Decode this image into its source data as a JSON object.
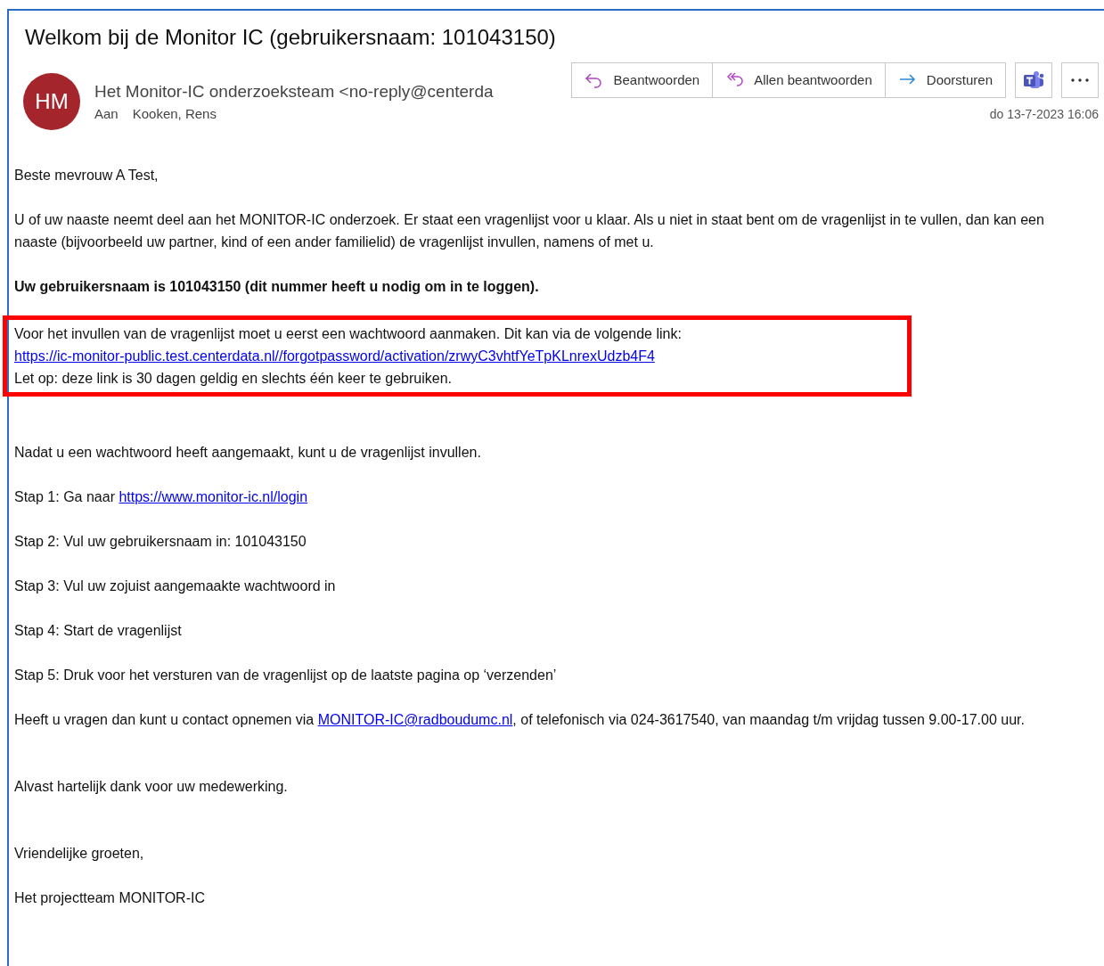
{
  "subject": "Welkom bij de Monitor IC (gebruikersnaam: 101043150)",
  "sender": {
    "initials": "HM",
    "color": "#a4262c",
    "name": "Het Monitor-IC onderzoeksteam <no-reply@centerda",
    "to_label": "Aan",
    "to": "Kooken, Rens"
  },
  "actions": [
    {
      "kind": "reply",
      "label": "Beantwoorden"
    },
    {
      "kind": "reply-all",
      "label": "Allen beantwoorden"
    },
    {
      "kind": "forward",
      "label": "Doorsturen"
    }
  ],
  "tools": [
    {
      "kind": "teams"
    },
    {
      "kind": "more"
    }
  ],
  "date": "do 13-7-2023 16:06",
  "body": [
    {
      "kind": "text",
      "lines": [
        [
          {
            "kind": "text",
            "text": "Beste mevrouw A Test,"
          }
        ]
      ]
    },
    {
      "kind": "text",
      "lines": [
        [
          {
            "kind": "text",
            "text": "U of uw naaste neemt deel aan het MONITOR-IC onderzoek. Er staat een vragenlijst voor u klaar. Als u niet in staat bent om de vragenlijst in te vullen, dan kan een naaste (bijvoorbeeld uw partner, kind of een ander familielid) de vragenlijst invullen, namens of met u."
          }
        ]
      ]
    },
    {
      "kind": "bold",
      "lines": [
        [
          {
            "kind": "text",
            "text": "Uw gebruikersnaam is 101043150 (dit nummer heeft u nodig om in te loggen)."
          }
        ]
      ]
    },
    {
      "kind": "highlighted",
      "lines": [
        [
          {
            "kind": "text",
            "text": "Voor het invullen van de vragenlijst moet u eerst een wachtwoord aanmaken. Dit kan via de volgende link: "
          },
          {
            "kind": "link",
            "text": "https://ic-monitor-public.test.centerdata.nl//forgotpassword/activation/zrwyC3vhtfYeTpKLnrexUdzb4F4"
          }
        ],
        [
          {
            "kind": "text",
            "text": "Let op: deze link is 30 dagen geldig en slechts één keer te gebruiken."
          }
        ]
      ]
    },
    {
      "kind": "blank"
    },
    {
      "kind": "text",
      "lines": [
        [
          {
            "kind": "text",
            "text": "Nadat u een wachtwoord heeft aangemaakt, kunt u de vragenlijst invullen."
          }
        ]
      ]
    },
    {
      "kind": "text",
      "lines": [
        [
          {
            "kind": "text",
            "text": "Stap 1: Ga naar "
          },
          {
            "kind": "link",
            "text": "https://www.monitor-ic.nl/login"
          }
        ]
      ]
    },
    {
      "kind": "text",
      "lines": [
        [
          {
            "kind": "text",
            "text": "Stap 2: Vul uw gebruikersnaam in: 101043150"
          }
        ]
      ]
    },
    {
      "kind": "text",
      "lines": [
        [
          {
            "kind": "text",
            "text": "Stap 3: Vul uw zojuist aangemaakte wachtwoord in"
          }
        ]
      ]
    },
    {
      "kind": "text",
      "lines": [
        [
          {
            "kind": "text",
            "text": "Stap 4: Start de vragenlijst"
          }
        ]
      ]
    },
    {
      "kind": "text",
      "lines": [
        [
          {
            "kind": "text",
            "text": "Stap 5: Druk voor het versturen van de vragenlijst op de laatste pagina op ‘verzenden’"
          }
        ]
      ]
    },
    {
      "kind": "text",
      "lines": [
        [
          {
            "kind": "text",
            "text": "Heeft u vragen dan kunt u contact opnemen via "
          },
          {
            "kind": "link",
            "text": "MONITOR-IC@radboudumc.nl"
          },
          {
            "kind": "text",
            "text": ", of telefonisch via 024-3617540, van maandag t/m vrijdag tussen 9.00-17.00 uur."
          }
        ]
      ]
    },
    {
      "kind": "blank"
    },
    {
      "kind": "text",
      "lines": [
        [
          {
            "kind": "text",
            "text": "Alvast hartelijk dank voor uw medewerking."
          }
        ]
      ]
    },
    {
      "kind": "blank"
    },
    {
      "kind": "text",
      "lines": [
        [
          {
            "kind": "text",
            "text": "Vriendelijke groeten,"
          }
        ]
      ]
    },
    {
      "kind": "text",
      "lines": [
        [
          {
            "kind": "text",
            "text": "Het projectteam MONITOR-IC"
          }
        ]
      ]
    }
  ]
}
